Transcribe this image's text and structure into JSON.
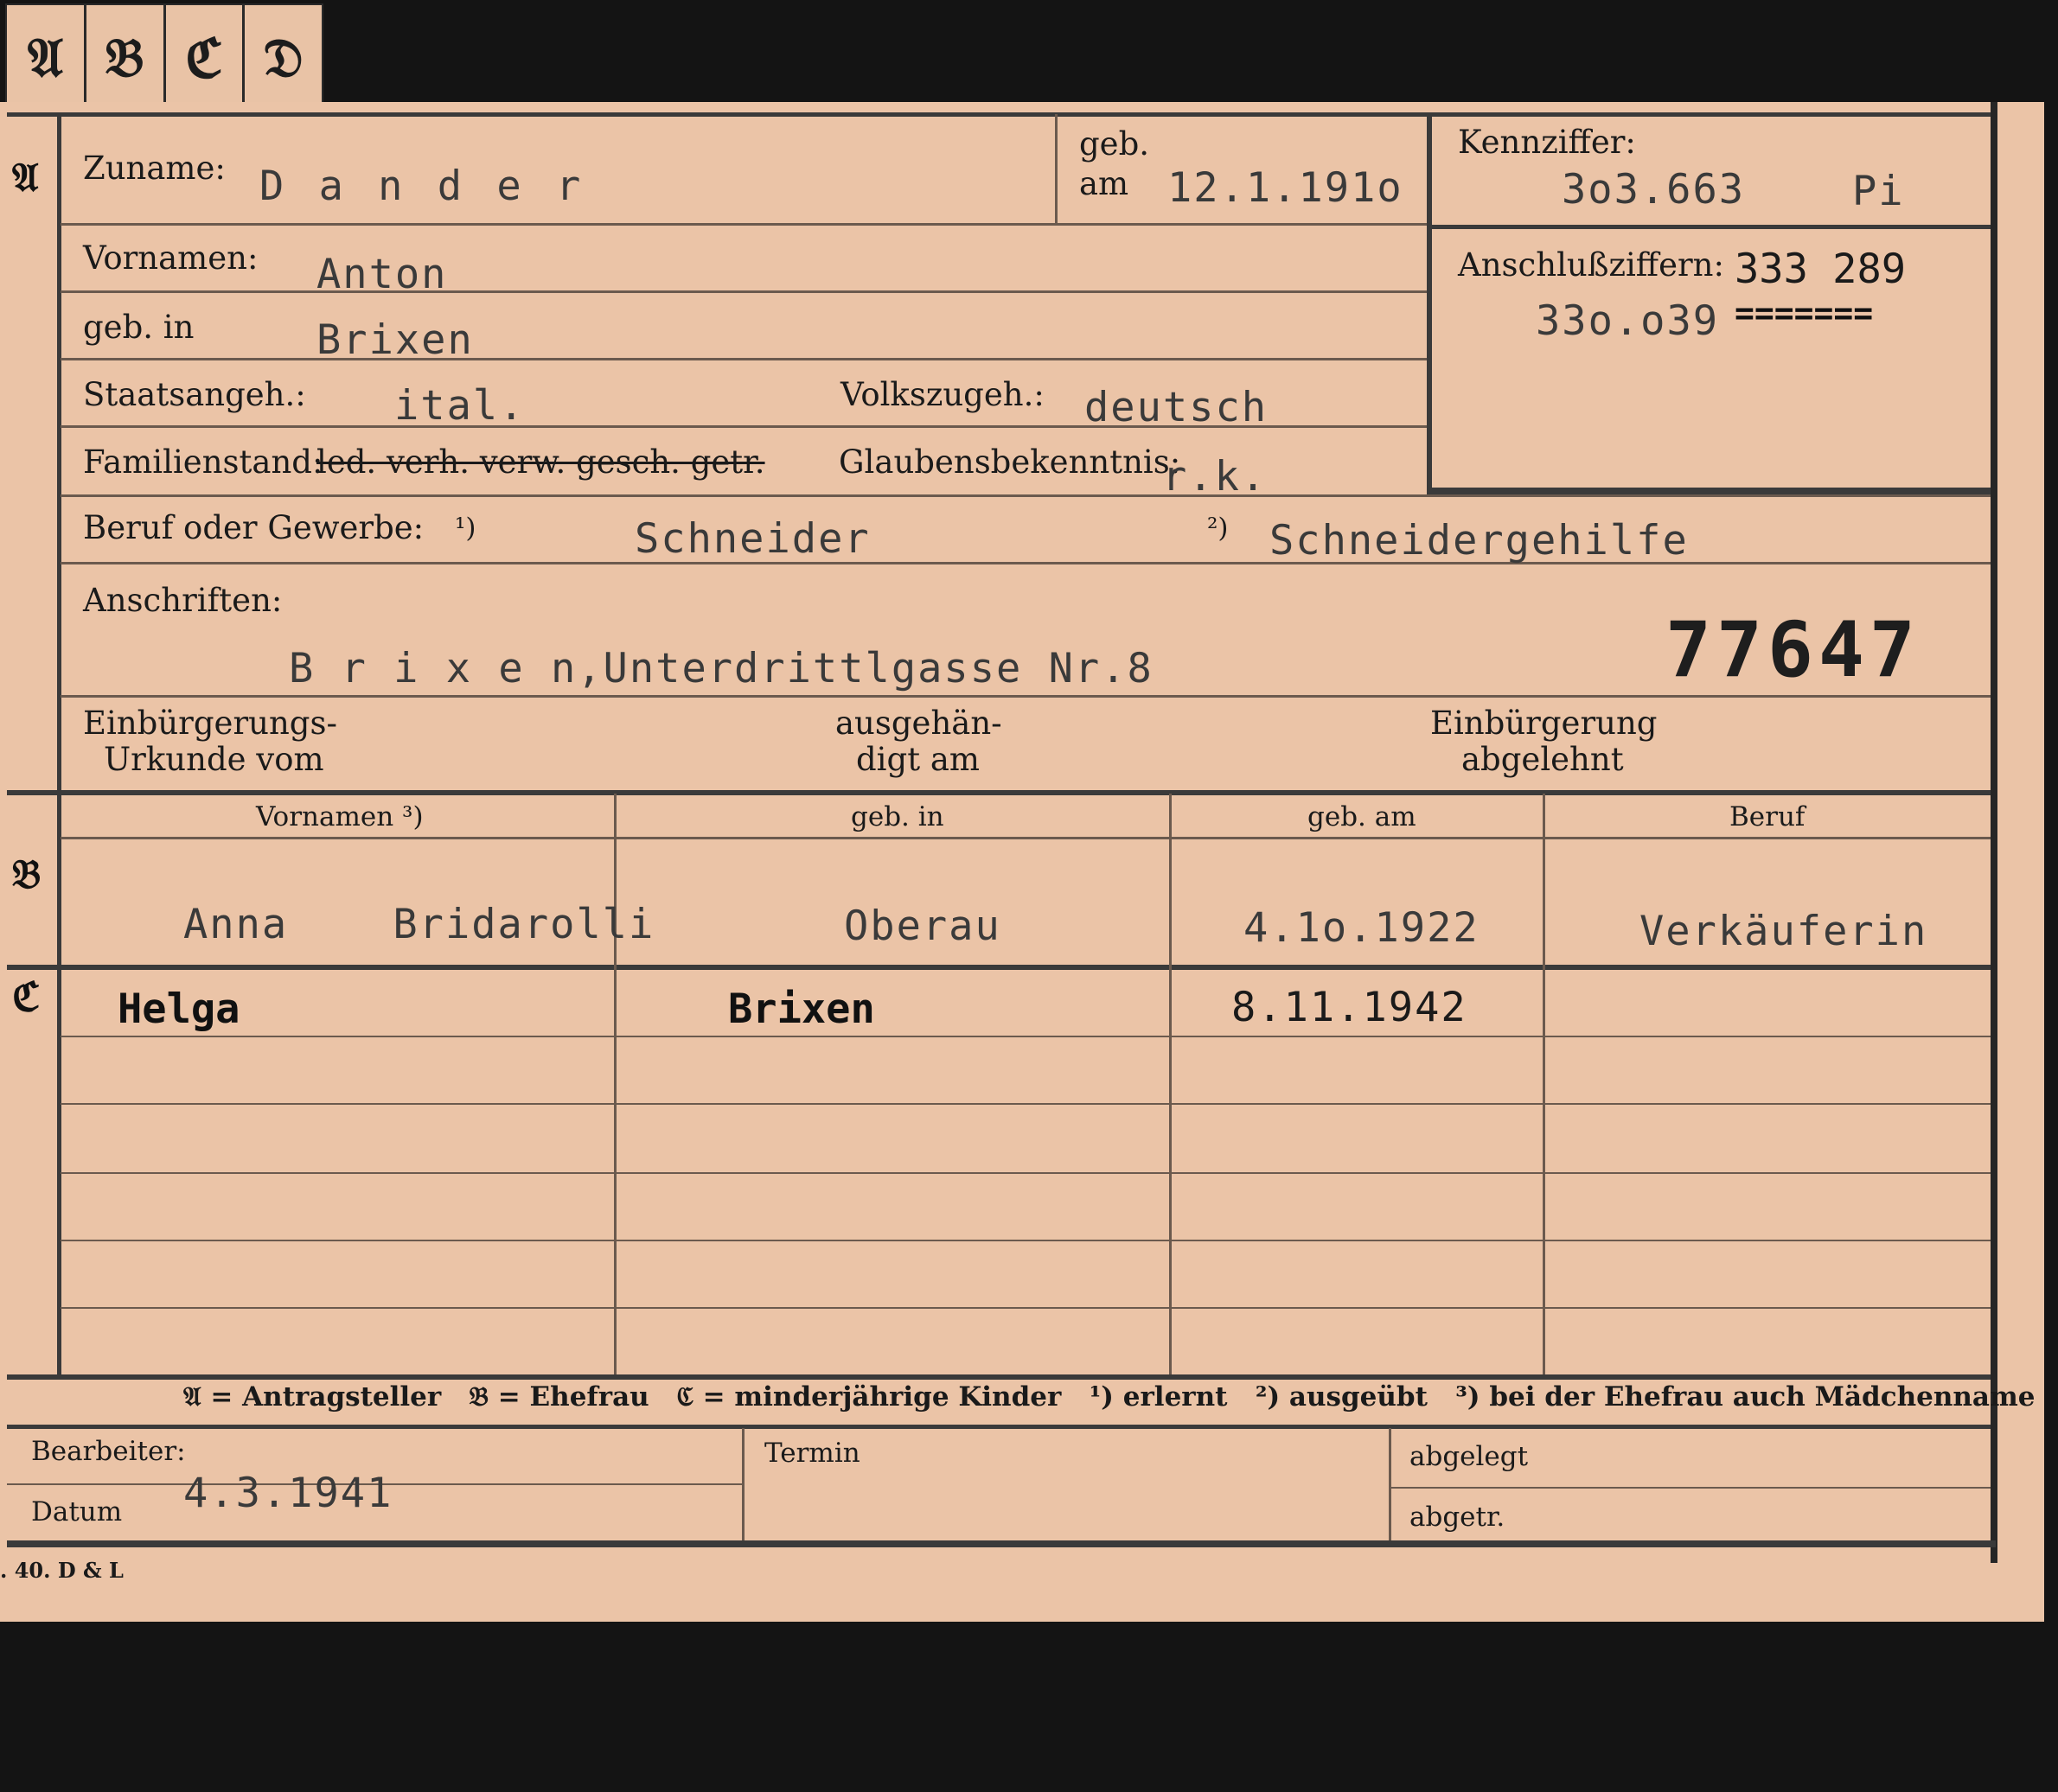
{
  "tabs": [
    "𝔄",
    "𝔅",
    "ℭ",
    "𝔇"
  ],
  "section_letters": {
    "a": "𝔄",
    "b": "𝔅",
    "c": "ℭ"
  },
  "labels": {
    "zuname": "Zuname:",
    "geb": "geb.",
    "am": "am",
    "vornamen": "Vornamen:",
    "geb_in": "geb. in",
    "staatsangeh": "Staatsangeh.:",
    "volkszugeh": "Volkszugeh.:",
    "familienstand": "Familienstand:",
    "familienstand_options": "led. verh. verw. gesch. getr.",
    "glaubensbekenntnis": "Glaubensbekenntnis:",
    "beruf": "Beruf oder Gewerbe:",
    "fn1": "¹)",
    "fn2": "²)",
    "anschriften": "Anschriften:",
    "einbuergerung_urkunde_1": "Einbürgerungs-",
    "einbuergerung_urkunde_2": "Urkunde vom",
    "ausgehaendigt_1": "ausgehän-",
    "ausgehaendigt_2": "digt am",
    "abgelehnt_1": "Einbürgerung",
    "abgelehnt_2": "abgelehnt",
    "kennziffer": "Kennziffer:",
    "anschlussziffern": "Anschlußziffern:",
    "bearbeiter": "Bearbeiter:",
    "datum": "Datum",
    "termin": "Termin",
    "abgelegt": "abgelegt",
    "abgetr": "abgetr."
  },
  "values": {
    "zuname": "D a n d e r",
    "geb_am": "12.1.191o",
    "vornamen": "Anton",
    "geb_in": "Brixen",
    "staatsangeh": "ital.",
    "volkszugeh": "deutsch",
    "glaubensbekenntnis": "r.k.",
    "beruf_1": "Schneider",
    "beruf_2": "Schneidergehilfe",
    "anschrift": "B r i x e n,Unterdrittlgasse Nr.8",
    "stamp_number": "77647",
    "kennziffer": "3o3.663",
    "kennziffer_suffix": "Pi",
    "anschluss_1": "333 289",
    "anschluss_2": "33o.o39",
    "anschluss_mark": "=======",
    "datum": "4.3.1941"
  },
  "table": {
    "headers": [
      "Vornamen ³)",
      "geb. in",
      "geb. am",
      "Beruf"
    ],
    "spouse": [
      "Anna    Bridarolli",
      "Oberau",
      "4.1o.1922",
      "Verkäuferin"
    ],
    "children": [
      [
        "Helga",
        "Brixen",
        "8.11.1942",
        ""
      ]
    ]
  },
  "legend": "𝔄 = Antragsteller   𝔅 = Ehefrau   ℭ = minderjährige Kinder   ¹) erlernt   ²) ausgeübt   ³) bei der Ehefrau auch Mädchenname",
  "imprint": ". 40. D & L"
}
